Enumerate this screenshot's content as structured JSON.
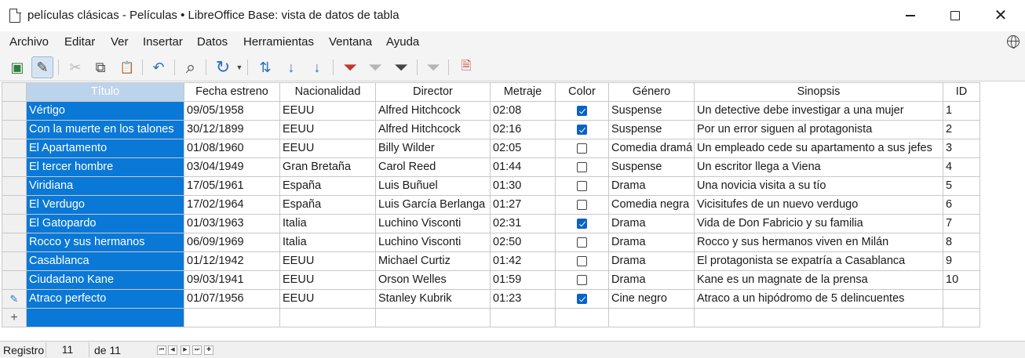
{
  "window": {
    "title": "películas clásicas - Películas • LibreOffice Base: vista de datos de tabla"
  },
  "menu": [
    {
      "label": "Archivo"
    },
    {
      "label": "Editar"
    },
    {
      "label": "Ver"
    },
    {
      "label": "Insertar"
    },
    {
      "label": "Datos"
    },
    {
      "label": "Herramientas"
    },
    {
      "label": "Ventana"
    },
    {
      "label": "Ayuda"
    }
  ],
  "toolbar": [
    {
      "icon": "save-record-icon",
      "glyph": "▣"
    },
    {
      "icon": "edit-data-icon",
      "glyph": "✎",
      "active": true
    },
    {
      "icon": "cut-icon",
      "glyph": "✂",
      "disabled": true
    },
    {
      "icon": "copy-icon",
      "glyph": "⧉"
    },
    {
      "icon": "paste-icon",
      "glyph": "📋",
      "disabled": true
    },
    {
      "icon": "undo-icon",
      "glyph": "↶"
    },
    {
      "icon": "find-icon",
      "glyph": "⌕"
    },
    {
      "icon": "refresh-icon",
      "glyph": "↻"
    },
    {
      "icon": "sort-icon",
      "glyph": "⇅"
    },
    {
      "icon": "sort-ascending-icon",
      "glyph": "↓"
    },
    {
      "icon": "sort-descending-icon",
      "glyph": "↓"
    },
    {
      "icon": "autofilter-icon",
      "glyph": "⏷"
    },
    {
      "icon": "apply-filter-icon",
      "glyph": "⏷",
      "disabled": true
    },
    {
      "icon": "standard-filter-icon",
      "glyph": "⏷"
    },
    {
      "icon": "reset-filter-icon",
      "glyph": "⏷",
      "disabled": true
    },
    {
      "icon": "delete-record-icon",
      "glyph": "🗎"
    }
  ],
  "table": {
    "columns": [
      "Título",
      "Fecha estreno",
      "Nacionalidad",
      "Director",
      "Metraje",
      "Color",
      "Género",
      "Sinopsis",
      "ID"
    ],
    "rows": [
      {
        "titulo": "Vértigo",
        "fecha": "09/05/1958",
        "nacionalidad": "EEUU",
        "director": "Alfred Hitchcock",
        "metraje": "02:08",
        "color": true,
        "genero": "Suspense",
        "sinopsis": "Un detective debe investigar a una mujer",
        "id": "1"
      },
      {
        "titulo": "Con la muerte en los talones",
        "fecha": "30/12/1899",
        "nacionalidad": "EEUU",
        "director": "Alfred Hitchcock",
        "metraje": "02:16",
        "color": true,
        "genero": "Suspense",
        "sinopsis": "Por un error siguen al protagonista",
        "id": "2"
      },
      {
        "titulo": "El Apartamento",
        "fecha": "01/08/1960",
        "nacionalidad": "EEUU",
        "director": "Billy Wilder",
        "metraje": "02:05",
        "color": false,
        "genero": "Comedia dramá",
        "sinopsis": "Un empleado cede su apartamento a sus jefes",
        "id": "3"
      },
      {
        "titulo": "El tercer hombre",
        "fecha": "03/04/1949",
        "nacionalidad": "Gran Bretaña",
        "director": "Carol Reed",
        "metraje": "01:44",
        "color": false,
        "genero": "Suspense",
        "sinopsis": "Un escritor llega a Viena",
        "id": "4"
      },
      {
        "titulo": "Viridiana",
        "fecha": "17/05/1961",
        "nacionalidad": "España",
        "director": "Luis Buñuel",
        "metraje": "01:30",
        "color": false,
        "genero": "Drama",
        "sinopsis": "Una novicia visita a su tío",
        "id": "5"
      },
      {
        "titulo": "El Verdugo",
        "fecha": "17/02/1964",
        "nacionalidad": "España",
        "director": "Luis García Berlanga",
        "metraje": "01:27",
        "color": false,
        "genero": "Comedia negra",
        "sinopsis": "Vicisitufes de un nuevo verdugo",
        "id": "6"
      },
      {
        "titulo": "El Gatopardo",
        "fecha": "01/03/1963",
        "nacionalidad": "Italia",
        "director": "Luchino Visconti",
        "metraje": "02:31",
        "color": true,
        "genero": "Drama",
        "sinopsis": "Vida de Don Fabricio y su familia",
        "id": "7"
      },
      {
        "titulo": "Rocco y sus hermanos",
        "fecha": "06/09/1969",
        "nacionalidad": "Italia",
        "director": "Luchino Visconti",
        "metraje": "02:50",
        "color": false,
        "genero": "Drama",
        "sinopsis": "Rocco y sus hermanos viven en Milán",
        "id": "8"
      },
      {
        "titulo": "Casablanca",
        "fecha": "01/12/1942",
        "nacionalidad": "EEUU",
        "director": "Michael Curtiz",
        "metraje": "01:42",
        "color": false,
        "genero": "Drama",
        "sinopsis": "El protagonista se expatría a Casablanca",
        "id": "9"
      },
      {
        "titulo": "Ciudadano Kane",
        "fecha": "09/03/1941",
        "nacionalidad": "EEUU",
        "director": "Orson Welles",
        "metraje": "01:59",
        "color": false,
        "genero": "Drama",
        "sinopsis": "Kane es un magnate de la prensa",
        "id": "10"
      },
      {
        "titulo": "Atraco perfecto",
        "fecha": "01/07/1956",
        "nacionalidad": "EEUU",
        "director": "Stanley Kubrik",
        "metraje": "01:23",
        "color": true,
        "genero": "Cine negro",
        "sinopsis": "Atraco a un hipódromo de 5 delincuentes",
        "id": ""
      }
    ]
  },
  "status": {
    "label": "Registro",
    "current": "11",
    "of": "de 11"
  },
  "colors": {
    "selection": "#0a78d7",
    "selected_header": "#bcd3ec",
    "checkbox_on": "#0a63c4"
  }
}
